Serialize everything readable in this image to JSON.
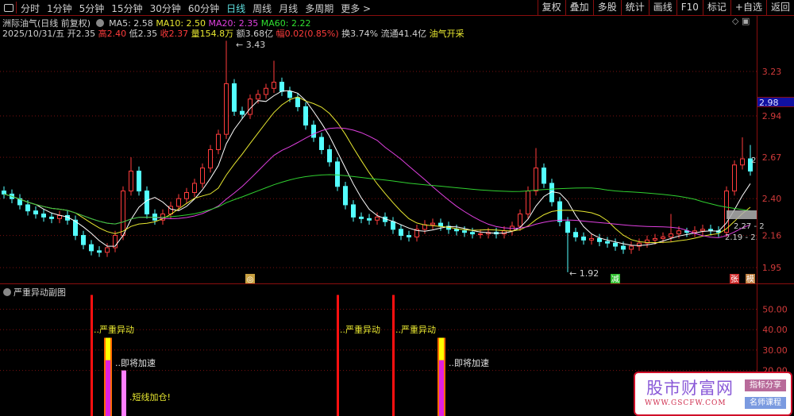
{
  "toolbar": {
    "periods": [
      "分时",
      "1分钟",
      "5分钟",
      "15分钟",
      "30分钟",
      "60分钟",
      "日线",
      "周线",
      "月线",
      "多周期",
      "更多 >"
    ],
    "active_period": "日线",
    "right_buttons": [
      "复权",
      "叠加",
      "多股",
      "统计",
      "画线",
      "F10",
      "标记",
      "+自选",
      "返回"
    ]
  },
  "info": {
    "title": "洲际油气(日线 前复权)",
    "ma5": "MA5: 2.58",
    "ma10": "MA10: 2.50",
    "ma20": "MA20: 2.35",
    "ma60": "MA60: 2.22",
    "date": "2025/10/31/五",
    "open_label": "开",
    "open": "2.35",
    "high_label": "高",
    "high": "2.40",
    "low_label": "低",
    "low": "2.35",
    "close_label": "收",
    "close": "2.37",
    "vol_label": "量",
    "vol": "154.8万",
    "amount_label": "额",
    "amount": "3.68亿",
    "chg_label": "幅",
    "chg": "0.02(0.85%)",
    "turnover": "换3.74%",
    "float": "流通41.4亿",
    "sector": "油气开采"
  },
  "colors": {
    "up": "#ff3c3c",
    "down": "#54ffff",
    "ma5": "#ffffff",
    "ma10": "#e8e830",
    "ma20": "#e040e0",
    "ma60": "#30d030",
    "grid": "#7a1010"
  },
  "current_price_tag": "2.98",
  "chart_data": [
    {
      "type": "candlestick",
      "y_ticks": [
        3.23,
        2.94,
        2.67,
        2.4,
        2.16,
        1.95
      ],
      "ylim": [
        1.87,
        3.55
      ],
      "open": [
        2.45,
        2.43,
        2.4,
        2.36,
        2.32,
        2.3,
        2.28,
        2.27,
        2.29,
        2.26,
        2.16,
        2.1,
        2.06,
        2.05,
        2.08,
        2.16,
        2.45,
        2.58,
        2.45,
        2.3,
        2.26,
        2.3,
        2.35,
        2.4,
        2.44,
        2.5,
        2.6,
        2.72,
        2.82,
        3.15,
        2.97,
        2.95,
        3.05,
        3.08,
        3.12,
        3.16,
        3.1,
        3.06,
        3.0,
        2.88,
        2.8,
        2.72,
        2.64,
        2.48,
        2.36,
        2.28,
        2.27,
        2.26,
        2.28,
        2.25,
        2.2,
        2.16,
        2.15,
        2.2,
        2.23,
        2.24,
        2.22,
        2.2,
        2.19,
        2.18,
        2.17,
        2.17,
        2.18,
        2.17,
        2.19,
        2.22,
        2.3,
        2.45,
        2.6,
        2.5,
        2.38,
        2.25,
        2.18,
        2.15,
        2.13,
        2.14,
        2.12,
        2.11,
        2.09,
        2.07,
        2.09,
        2.11,
        2.13,
        2.14,
        2.15,
        2.17,
        2.19,
        2.18,
        2.19,
        2.2,
        2.19,
        2.18,
        2.45,
        2.62,
        2.66
      ],
      "high": [
        2.48,
        2.46,
        2.43,
        2.39,
        2.35,
        2.33,
        2.31,
        2.32,
        2.32,
        2.29,
        2.19,
        2.13,
        2.09,
        2.11,
        2.19,
        2.48,
        2.67,
        2.61,
        2.48,
        2.33,
        2.33,
        2.38,
        2.43,
        2.47,
        2.53,
        2.63,
        2.75,
        2.85,
        3.43,
        3.18,
        3.0,
        3.08,
        3.11,
        3.15,
        3.3,
        3.19,
        3.13,
        3.09,
        3.03,
        2.91,
        2.83,
        2.75,
        2.67,
        2.51,
        2.39,
        2.31,
        2.3,
        2.31,
        2.31,
        2.28,
        2.23,
        2.19,
        2.23,
        2.26,
        2.27,
        2.27,
        2.25,
        2.23,
        2.22,
        2.21,
        2.2,
        2.21,
        2.21,
        2.22,
        2.25,
        2.33,
        2.48,
        2.73,
        2.63,
        2.53,
        2.41,
        2.28,
        2.21,
        2.18,
        2.17,
        2.17,
        2.15,
        2.14,
        2.12,
        2.12,
        2.14,
        2.16,
        2.17,
        2.18,
        2.3,
        2.22,
        2.21,
        2.22,
        2.23,
        2.23,
        2.22,
        2.48,
        2.65,
        2.8,
        2.75
      ],
      "low": [
        2.4,
        2.37,
        2.33,
        2.29,
        2.27,
        2.25,
        2.24,
        2.24,
        2.23,
        2.13,
        2.07,
        2.03,
        2.02,
        2.02,
        2.05,
        2.13,
        2.42,
        2.42,
        2.27,
        2.23,
        2.23,
        2.27,
        2.32,
        2.37,
        2.41,
        2.47,
        2.57,
        2.69,
        2.79,
        2.94,
        2.92,
        2.92,
        3.02,
        3.05,
        3.09,
        3.07,
        3.03,
        2.97,
        2.85,
        2.77,
        2.69,
        2.61,
        2.45,
        2.33,
        2.25,
        2.24,
        2.23,
        2.23,
        2.22,
        2.17,
        2.13,
        2.12,
        2.12,
        2.17,
        2.2,
        2.19,
        2.17,
        2.16,
        2.15,
        2.14,
        2.14,
        2.14,
        2.14,
        2.14,
        2.16,
        2.19,
        2.27,
        2.42,
        2.47,
        2.35,
        2.22,
        1.92,
        2.12,
        2.1,
        2.1,
        2.09,
        2.08,
        2.06,
        2.04,
        2.04,
        2.06,
        2.08,
        2.1,
        2.11,
        2.12,
        2.14,
        2.15,
        2.15,
        2.16,
        2.16,
        2.15,
        2.15,
        2.42,
        2.59,
        2.55
      ],
      "close": [
        2.43,
        2.4,
        2.36,
        2.32,
        2.3,
        2.28,
        2.27,
        2.29,
        2.26,
        2.16,
        2.1,
        2.06,
        2.05,
        2.08,
        2.16,
        2.45,
        2.58,
        2.45,
        2.3,
        2.26,
        2.3,
        2.35,
        2.4,
        2.44,
        2.5,
        2.6,
        2.72,
        2.82,
        3.15,
        2.97,
        2.95,
        3.05,
        3.08,
        3.12,
        3.16,
        3.1,
        3.06,
        3.0,
        2.88,
        2.8,
        2.72,
        2.64,
        2.48,
        2.36,
        2.28,
        2.27,
        2.26,
        2.28,
        2.25,
        2.2,
        2.16,
        2.15,
        2.2,
        2.23,
        2.24,
        2.22,
        2.2,
        2.19,
        2.18,
        2.17,
        2.17,
        2.18,
        2.17,
        2.19,
        2.22,
        2.3,
        2.45,
        2.6,
        2.5,
        2.38,
        2.25,
        2.18,
        2.15,
        2.13,
        2.14,
        2.12,
        2.11,
        2.09,
        2.07,
        2.09,
        2.11,
        2.13,
        2.14,
        2.15,
        2.17,
        2.19,
        2.18,
        2.19,
        2.2,
        2.19,
        2.18,
        2.45,
        2.62,
        2.66,
        2.58
      ],
      "moving_averages": [
        "MA5",
        "MA10",
        "MA20",
        "MA60"
      ],
      "annotations": {
        "max_label": "3.43",
        "min_label": "1.92",
        "range1": "2.27 - 2",
        "range2": "2.19 - 2.",
        "last_marker": "2"
      },
      "markers": [
        {
          "bar": 31,
          "text": "◎",
          "color": "#c8a040"
        },
        {
          "bar": 77,
          "text": "减",
          "color": "#30c030"
        },
        {
          "bar": 92,
          "text": "张",
          "color": "#d03030"
        },
        {
          "bar": 94,
          "text": "模",
          "color": "#c08040"
        }
      ]
    },
    {
      "type": "bar",
      "title": "严重异动副图",
      "y_ticks": [
        "50.00",
        "40.00",
        "30.00",
        "20.00"
      ],
      "ylim": [
        0,
        58
      ],
      "signals": [
        {
          "bar": 11,
          "kind": "severe",
          "value": 57,
          "label": "严重异动"
        },
        {
          "bar": 13,
          "kind": "accelerate",
          "value": 36,
          "split": 25,
          "label": "即将加速"
        },
        {
          "bar": 15,
          "kind": "add",
          "value": 20,
          "label": "短线加仓!"
        },
        {
          "bar": 42,
          "kind": "severe",
          "value": 57,
          "label": "严重异动"
        },
        {
          "bar": 49,
          "kind": "severe",
          "value": 57,
          "label": "严重异动"
        },
        {
          "bar": 55,
          "kind": "accelerate",
          "value": 36,
          "split": 25,
          "label": "即将加速"
        }
      ]
    }
  ],
  "watermark": {
    "name": "股市财富网",
    "url": "WWW.GSCFW.COM",
    "tag1": "指标分享",
    "tag2": "名师课程"
  }
}
